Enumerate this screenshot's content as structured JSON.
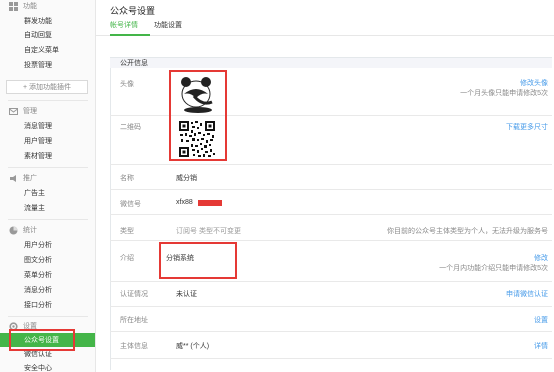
{
  "sidebar": {
    "sections": [
      {
        "label": "功能",
        "icon": "function-icon",
        "items": [
          "群发功能",
          "自动回复",
          "自定义菜单",
          "投票管理"
        ]
      },
      {
        "label": "管理",
        "icon": "manage-icon",
        "items": [
          "消息管理",
          "用户管理",
          "素材管理"
        ]
      },
      {
        "label": "推广",
        "icon": "promote-icon",
        "items": [
          "广告主",
          "流量主"
        ]
      },
      {
        "label": "统计",
        "icon": "stats-icon",
        "items": [
          "用户分析",
          "图文分析",
          "菜单分析",
          "消息分析",
          "接口分析"
        ]
      },
      {
        "label": "设置",
        "icon": "settings-icon",
        "items": [
          "公众号设置",
          "微信认证",
          "安全中心"
        ]
      }
    ],
    "add_plugin": "+ 添加功能插件"
  },
  "page": {
    "title": "公众号设置",
    "tabs": [
      "帐号详情",
      "功能设置"
    ],
    "active_tab": 0
  },
  "info": {
    "header": "公开信息",
    "avatar": {
      "label": "头像",
      "action": "修改头像",
      "note": "一个月头像只能申请修改5次"
    },
    "qrcode": {
      "label": "二维码",
      "action": "下载更多尺寸"
    },
    "name": {
      "label": "名称",
      "value": "威分销"
    },
    "wechat_id": {
      "label": "微信号",
      "value": "xfx88"
    },
    "type": {
      "label": "类型",
      "value": "订阅号 类型不可变更",
      "note": "你目前的公众号主体类型为个人，无法升级为服务号"
    },
    "intro": {
      "label": "介绍",
      "value": "分销系统",
      "action": "修改",
      "note": "一个月内功能介绍只能申请修改5次"
    },
    "verify": {
      "label": "认证情况",
      "value": "未认证",
      "action": "申请微信认证"
    },
    "address": {
      "label": "所在地址",
      "action": "设置"
    },
    "owner": {
      "label": "主体信息",
      "value": "威** (个人)",
      "action": "详情"
    }
  },
  "colors": {
    "accent": "#44b549",
    "link": "#459ae9",
    "highlight": "#e53935"
  }
}
